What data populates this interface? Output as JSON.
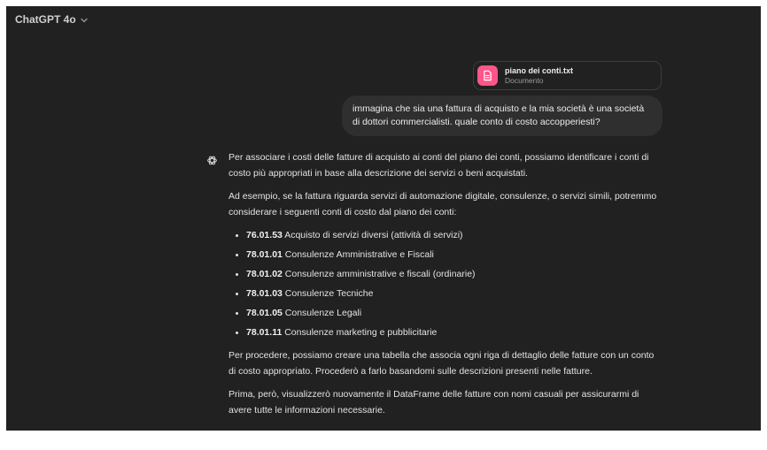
{
  "header": {
    "title": "ChatGPT 4o",
    "chevron_icon": "chevron-down-icon"
  },
  "attachment": {
    "name": "piano dei conti.txt",
    "type": "Documento",
    "icon": "document-icon",
    "accent": "#ff5588"
  },
  "user_message": "immagina che sia una fattura di acquisto e la mia società è una società di dottori commercialisti. quale conto di costo accopperiesti?",
  "assistant": {
    "avatar_icon": "openai-logo-icon",
    "p1": "Per associare i costi delle fatture di acquisto ai conti del piano dei conti, possiamo identificare i conti di costo più appropriati in base alla descrizione dei servizi o beni acquistati.",
    "p2": "Ad esempio, se la fattura riguarda servizi di automazione digitale, consulenze, o servizi simili, potremmo considerare i seguenti conti di costo dal piano dei conti:",
    "items": [
      {
        "code": "76.01.53",
        "label": "Acquisto di servizi diversi (attività di servizi)"
      },
      {
        "code": "78.01.01",
        "label": "Consulenze Amministrative e Fiscali"
      },
      {
        "code": "78.01.02",
        "label": "Consulenze amministrative e fiscali (ordinarie)"
      },
      {
        "code": "78.01.03",
        "label": "Consulenze Tecniche"
      },
      {
        "code": "78.01.05",
        "label": "Consulenze Legali"
      },
      {
        "code": "78.01.11",
        "label": "Consulenze marketing e pubblicitarie"
      }
    ],
    "p3": "Per procedere, possiamo creare una tabella che associa ogni riga di dettaglio delle fatture con un conto di costo appropriato. Procederò a farlo basandomi sulle descrizioni presenti nelle fatture.",
    "p4": "Prima, però, visualizzerò nuovamente il DataFrame delle fatture con nomi casuali per assicurarmi di avere tutte le informazioni necessarie."
  },
  "colors": {
    "background": "#212121",
    "bubble": "#2f2f2f",
    "text": "#e3e3e3"
  }
}
